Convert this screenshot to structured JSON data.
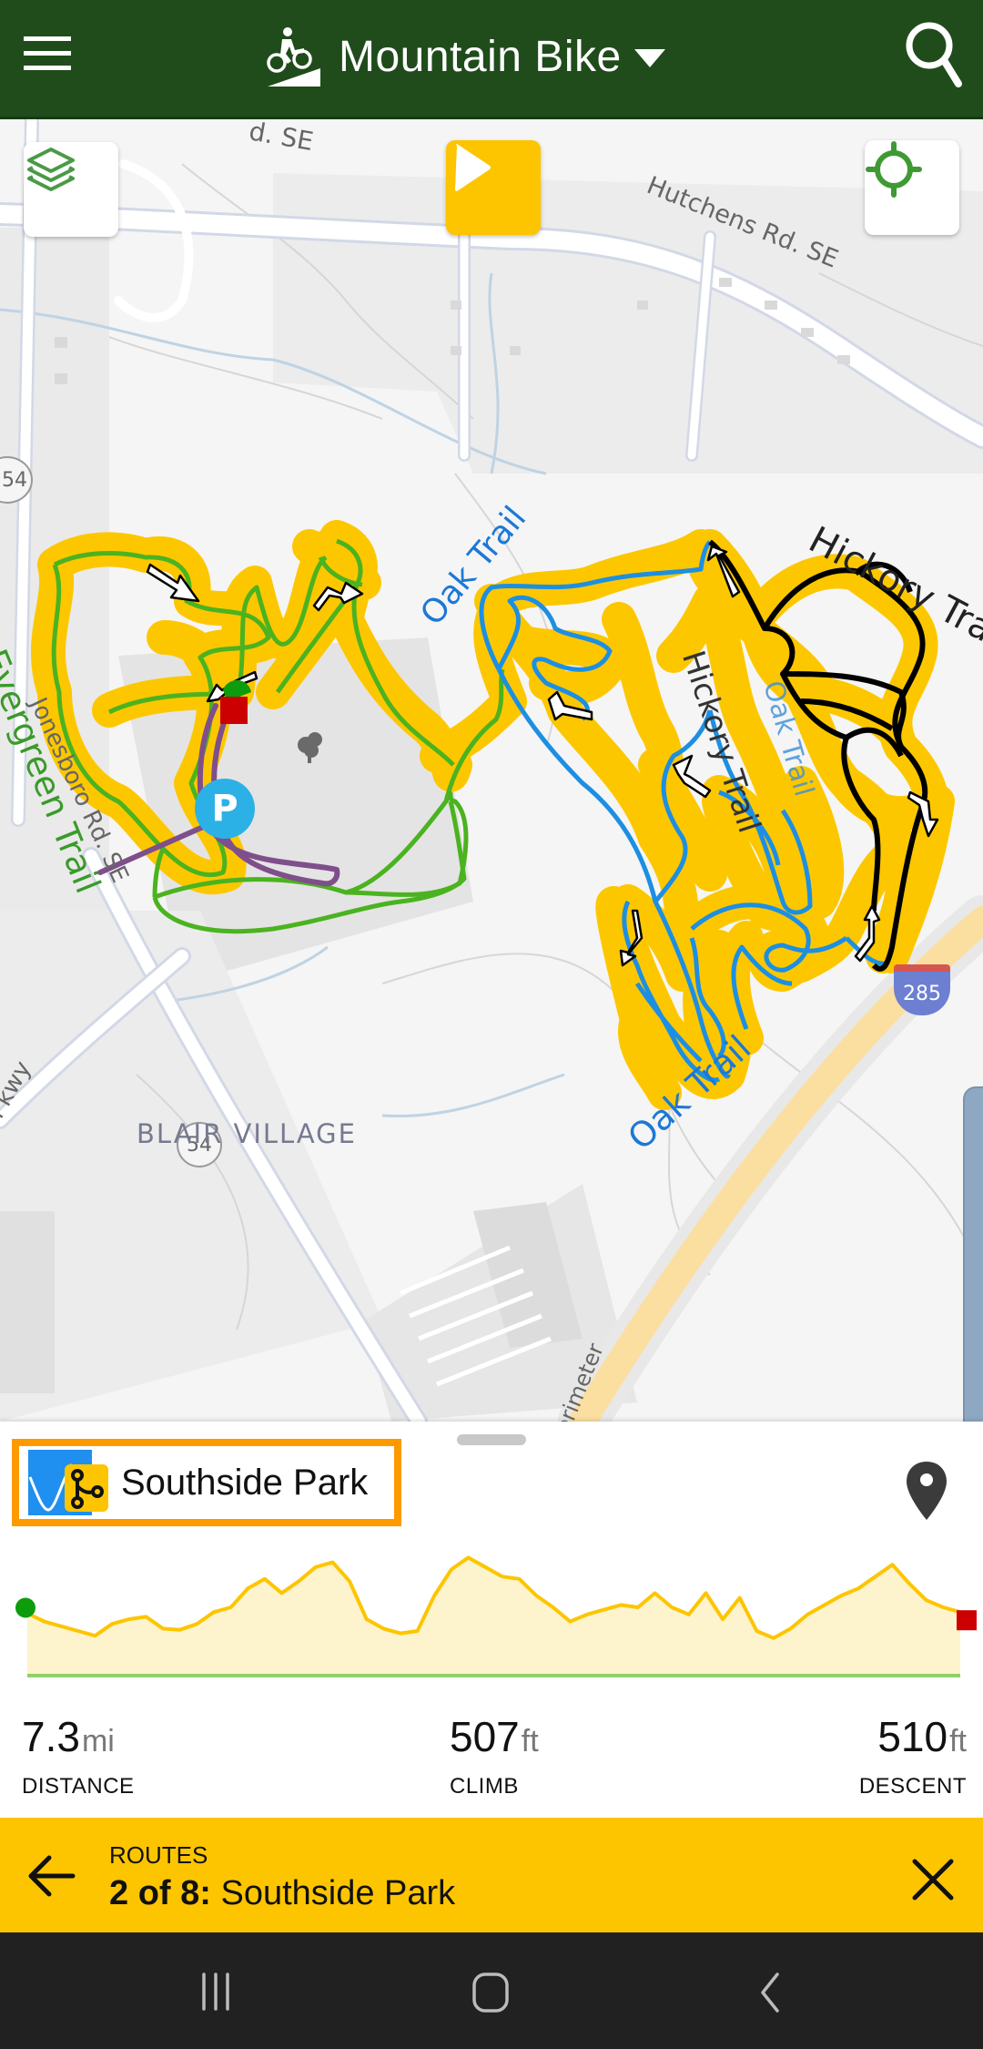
{
  "header": {
    "title": "Mountain Bike",
    "activity_icon": "mountain-bike-icon",
    "menu_icon": "hamburger-menu-icon",
    "search_icon": "search-icon",
    "bg_color": "#204c1c"
  },
  "map": {
    "buttons": {
      "layers_icon": "layers-icon",
      "play_icon": "play-icon",
      "locate_icon": "crosshair-locate-icon"
    },
    "labels": {
      "hutchens": "Hutchens Rd. SE",
      "rd_se_top": "d. SE",
      "hickory_1": "Hickory Trail",
      "hickory_2": "Hickory Trail",
      "oak_1": "Oak Trail",
      "oak_2": "Oak Trail",
      "oak_3": "Oak Trail",
      "evergreen": "Evergreen Trail",
      "jonesboro": "Jonesboro Rd. SE",
      "blair_village": "BLAIR VILLAGE",
      "pkwy": "Pkwy",
      "perimeter": "Perimeter",
      "route_54_a": "54",
      "route_54_b": "54",
      "interstate": "285",
      "parking": "P"
    },
    "colors": {
      "route_highlight": "#fdc700",
      "evergreen_trail": "#4bb31f",
      "oak_trail": "#1c8fe3",
      "hickory_trail": "#000000",
      "access_path": "#7f4f8b",
      "parking": "#2cb1e6"
    }
  },
  "sheet": {
    "route_name": "Southside Park",
    "route_icon": "elevation-route-icon",
    "pin_icon": "map-pin-icon",
    "elevation_profile": {
      "start_marker": "green-circle",
      "end_marker": "red-square",
      "line_color": "#fdc500",
      "fill_color": "#fdf3cc"
    },
    "stats": [
      {
        "value": "7.3",
        "unit": "mi",
        "label": "DISTANCE"
      },
      {
        "value": "507",
        "unit": "ft",
        "label": "CLIMB"
      },
      {
        "value": "510",
        "unit": "ft",
        "label": "DESCENT"
      }
    ]
  },
  "banner": {
    "label": "ROUTES",
    "position": "2 of 8:",
    "title": "Southside Park",
    "back_icon": "arrow-left-icon",
    "close_icon": "close-icon",
    "bg_color": "#fdc500"
  },
  "navbar": {
    "recents_icon": "recents-icon",
    "home_icon": "home-icon",
    "back_icon": "back-chevron-icon"
  }
}
